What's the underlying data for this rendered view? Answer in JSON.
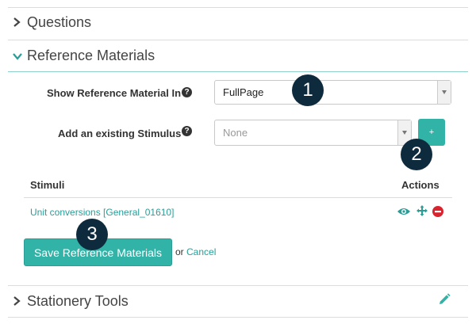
{
  "sections": {
    "questions": {
      "title": "Questions"
    },
    "reference": {
      "title": "Reference Materials"
    },
    "stationery": {
      "title": "Stationery Tools"
    }
  },
  "form": {
    "show_in_label": "Show Reference Material In",
    "show_in_value": "FullPage",
    "add_stimulus_label": "Add an existing Stimulus",
    "add_stimulus_value": "None",
    "add_button_label": "+"
  },
  "table": {
    "headers": {
      "stimuli": "Stimuli",
      "actions": "Actions"
    },
    "rows": [
      {
        "name": "Unit conversions [General_01610]"
      }
    ]
  },
  "footer": {
    "save_label": "Save Reference Materials",
    "or_text": "or",
    "cancel_label": "Cancel"
  },
  "callouts": [
    "1",
    "2",
    "3"
  ],
  "colors": {
    "accent": "#31b3a8",
    "accent_dark": "#2a9d97",
    "danger": "#d9232f",
    "callout": "#0e2a3d"
  },
  "icons": [
    "chevron-right-icon",
    "chevron-down-icon",
    "help-icon",
    "eye-icon",
    "move-icon",
    "remove-icon",
    "pencil-icon"
  ]
}
